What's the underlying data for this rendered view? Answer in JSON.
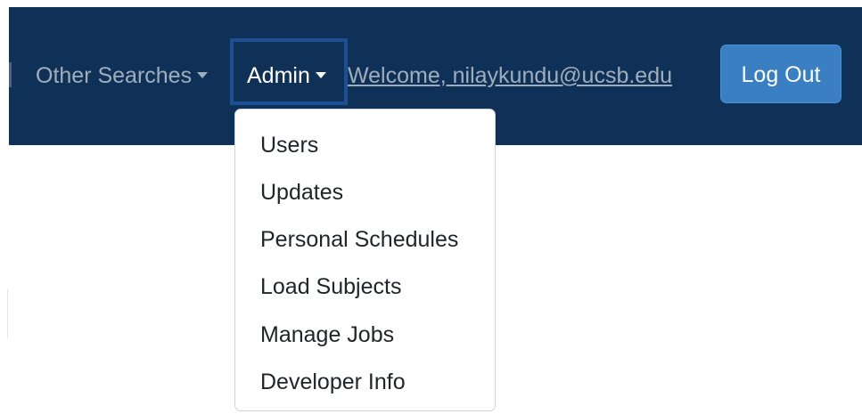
{
  "navbar": {
    "other_searches_label": "Other Searches",
    "admin_label": "Admin",
    "welcome_text": "Welcome, nilaykundu@ucsb.edu",
    "logout_label": "Log Out"
  },
  "admin_menu": {
    "items": [
      "Users",
      "Updates",
      "Personal Schedules",
      "Load Subjects",
      "Manage Jobs",
      "Developer Info"
    ]
  },
  "colors": {
    "navbar_bg": "#0f3157",
    "logout_bg": "#3a7fc2",
    "admin_focus_border": "#1c4f94"
  }
}
